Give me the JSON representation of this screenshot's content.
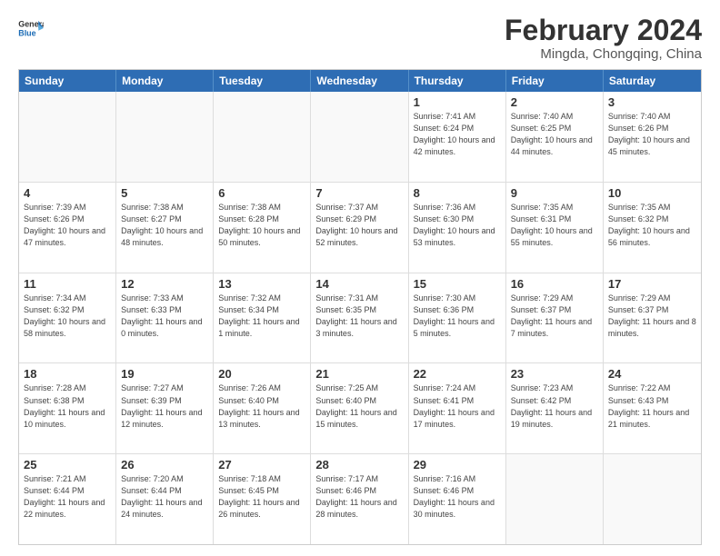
{
  "logo": {
    "text_general": "General",
    "text_blue": "Blue"
  },
  "header": {
    "month": "February 2024",
    "location": "Mingda, Chongqing, China"
  },
  "days_of_week": [
    "Sunday",
    "Monday",
    "Tuesday",
    "Wednesday",
    "Thursday",
    "Friday",
    "Saturday"
  ],
  "weeks": [
    [
      {
        "day": "",
        "sunrise": "",
        "sunset": "",
        "daylight": "",
        "empty": true
      },
      {
        "day": "",
        "sunrise": "",
        "sunset": "",
        "daylight": "",
        "empty": true
      },
      {
        "day": "",
        "sunrise": "",
        "sunset": "",
        "daylight": "",
        "empty": true
      },
      {
        "day": "",
        "sunrise": "",
        "sunset": "",
        "daylight": "",
        "empty": true
      },
      {
        "day": "1",
        "sunrise": "Sunrise: 7:41 AM",
        "sunset": "Sunset: 6:24 PM",
        "daylight": "Daylight: 10 hours and 42 minutes.",
        "empty": false
      },
      {
        "day": "2",
        "sunrise": "Sunrise: 7:40 AM",
        "sunset": "Sunset: 6:25 PM",
        "daylight": "Daylight: 10 hours and 44 minutes.",
        "empty": false
      },
      {
        "day": "3",
        "sunrise": "Sunrise: 7:40 AM",
        "sunset": "Sunset: 6:26 PM",
        "daylight": "Daylight: 10 hours and 45 minutes.",
        "empty": false
      }
    ],
    [
      {
        "day": "4",
        "sunrise": "Sunrise: 7:39 AM",
        "sunset": "Sunset: 6:26 PM",
        "daylight": "Daylight: 10 hours and 47 minutes.",
        "empty": false
      },
      {
        "day": "5",
        "sunrise": "Sunrise: 7:38 AM",
        "sunset": "Sunset: 6:27 PM",
        "daylight": "Daylight: 10 hours and 48 minutes.",
        "empty": false
      },
      {
        "day": "6",
        "sunrise": "Sunrise: 7:38 AM",
        "sunset": "Sunset: 6:28 PM",
        "daylight": "Daylight: 10 hours and 50 minutes.",
        "empty": false
      },
      {
        "day": "7",
        "sunrise": "Sunrise: 7:37 AM",
        "sunset": "Sunset: 6:29 PM",
        "daylight": "Daylight: 10 hours and 52 minutes.",
        "empty": false
      },
      {
        "day": "8",
        "sunrise": "Sunrise: 7:36 AM",
        "sunset": "Sunset: 6:30 PM",
        "daylight": "Daylight: 10 hours and 53 minutes.",
        "empty": false
      },
      {
        "day": "9",
        "sunrise": "Sunrise: 7:35 AM",
        "sunset": "Sunset: 6:31 PM",
        "daylight": "Daylight: 10 hours and 55 minutes.",
        "empty": false
      },
      {
        "day": "10",
        "sunrise": "Sunrise: 7:35 AM",
        "sunset": "Sunset: 6:32 PM",
        "daylight": "Daylight: 10 hours and 56 minutes.",
        "empty": false
      }
    ],
    [
      {
        "day": "11",
        "sunrise": "Sunrise: 7:34 AM",
        "sunset": "Sunset: 6:32 PM",
        "daylight": "Daylight: 10 hours and 58 minutes.",
        "empty": false
      },
      {
        "day": "12",
        "sunrise": "Sunrise: 7:33 AM",
        "sunset": "Sunset: 6:33 PM",
        "daylight": "Daylight: 11 hours and 0 minutes.",
        "empty": false
      },
      {
        "day": "13",
        "sunrise": "Sunrise: 7:32 AM",
        "sunset": "Sunset: 6:34 PM",
        "daylight": "Daylight: 11 hours and 1 minute.",
        "empty": false
      },
      {
        "day": "14",
        "sunrise": "Sunrise: 7:31 AM",
        "sunset": "Sunset: 6:35 PM",
        "daylight": "Daylight: 11 hours and 3 minutes.",
        "empty": false
      },
      {
        "day": "15",
        "sunrise": "Sunrise: 7:30 AM",
        "sunset": "Sunset: 6:36 PM",
        "daylight": "Daylight: 11 hours and 5 minutes.",
        "empty": false
      },
      {
        "day": "16",
        "sunrise": "Sunrise: 7:29 AM",
        "sunset": "Sunset: 6:37 PM",
        "daylight": "Daylight: 11 hours and 7 minutes.",
        "empty": false
      },
      {
        "day": "17",
        "sunrise": "Sunrise: 7:29 AM",
        "sunset": "Sunset: 6:37 PM",
        "daylight": "Daylight: 11 hours and 8 minutes.",
        "empty": false
      }
    ],
    [
      {
        "day": "18",
        "sunrise": "Sunrise: 7:28 AM",
        "sunset": "Sunset: 6:38 PM",
        "daylight": "Daylight: 11 hours and 10 minutes.",
        "empty": false
      },
      {
        "day": "19",
        "sunrise": "Sunrise: 7:27 AM",
        "sunset": "Sunset: 6:39 PM",
        "daylight": "Daylight: 11 hours and 12 minutes.",
        "empty": false
      },
      {
        "day": "20",
        "sunrise": "Sunrise: 7:26 AM",
        "sunset": "Sunset: 6:40 PM",
        "daylight": "Daylight: 11 hours and 13 minutes.",
        "empty": false
      },
      {
        "day": "21",
        "sunrise": "Sunrise: 7:25 AM",
        "sunset": "Sunset: 6:40 PM",
        "daylight": "Daylight: 11 hours and 15 minutes.",
        "empty": false
      },
      {
        "day": "22",
        "sunrise": "Sunrise: 7:24 AM",
        "sunset": "Sunset: 6:41 PM",
        "daylight": "Daylight: 11 hours and 17 minutes.",
        "empty": false
      },
      {
        "day": "23",
        "sunrise": "Sunrise: 7:23 AM",
        "sunset": "Sunset: 6:42 PM",
        "daylight": "Daylight: 11 hours and 19 minutes.",
        "empty": false
      },
      {
        "day": "24",
        "sunrise": "Sunrise: 7:22 AM",
        "sunset": "Sunset: 6:43 PM",
        "daylight": "Daylight: 11 hours and 21 minutes.",
        "empty": false
      }
    ],
    [
      {
        "day": "25",
        "sunrise": "Sunrise: 7:21 AM",
        "sunset": "Sunset: 6:44 PM",
        "daylight": "Daylight: 11 hours and 22 minutes.",
        "empty": false
      },
      {
        "day": "26",
        "sunrise": "Sunrise: 7:20 AM",
        "sunset": "Sunset: 6:44 PM",
        "daylight": "Daylight: 11 hours and 24 minutes.",
        "empty": false
      },
      {
        "day": "27",
        "sunrise": "Sunrise: 7:18 AM",
        "sunset": "Sunset: 6:45 PM",
        "daylight": "Daylight: 11 hours and 26 minutes.",
        "empty": false
      },
      {
        "day": "28",
        "sunrise": "Sunrise: 7:17 AM",
        "sunset": "Sunset: 6:46 PM",
        "daylight": "Daylight: 11 hours and 28 minutes.",
        "empty": false
      },
      {
        "day": "29",
        "sunrise": "Sunrise: 7:16 AM",
        "sunset": "Sunset: 6:46 PM",
        "daylight": "Daylight: 11 hours and 30 minutes.",
        "empty": false
      },
      {
        "day": "",
        "sunrise": "",
        "sunset": "",
        "daylight": "",
        "empty": true
      },
      {
        "day": "",
        "sunrise": "",
        "sunset": "",
        "daylight": "",
        "empty": true
      }
    ]
  ]
}
